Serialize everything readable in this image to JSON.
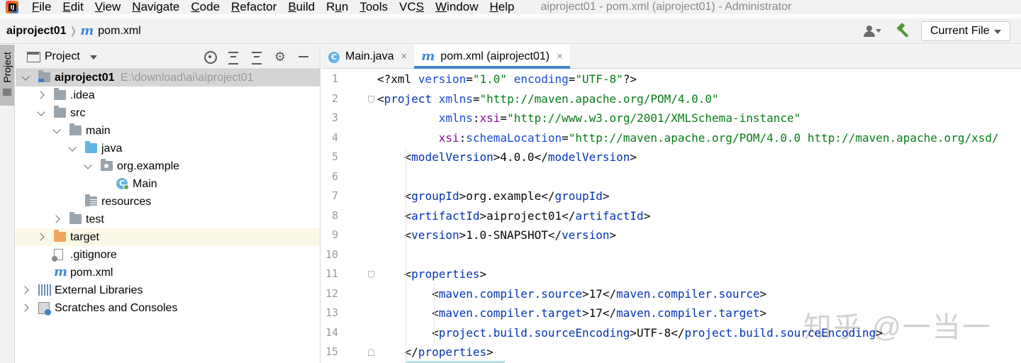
{
  "menubar": {
    "items": [
      {
        "label": "File",
        "mnemonic": "F",
        "rest": "ile"
      },
      {
        "label": "Edit",
        "mnemonic": "E",
        "rest": "dit"
      },
      {
        "label": "View",
        "mnemonic": "V",
        "rest": "iew"
      },
      {
        "label": "Navigate",
        "mnemonic": "N",
        "rest": "avigate"
      },
      {
        "label": "Code",
        "mnemonic": "C",
        "rest": "ode"
      },
      {
        "label": "Refactor",
        "mnemonic": "R",
        "rest": "efactor"
      },
      {
        "label": "Build",
        "mnemonic": "B",
        "rest": "uild"
      },
      {
        "label": "Run",
        "mnemonic": "u",
        "pre": "R",
        "rest": "n"
      },
      {
        "label": "Tools",
        "mnemonic": "T",
        "rest": "ools"
      },
      {
        "label": "VCS",
        "mnemonic": "S",
        "pre": "VC",
        "rest": ""
      },
      {
        "label": "Window",
        "mnemonic": "W",
        "rest": "indow"
      },
      {
        "label": "Help",
        "mnemonic": "H",
        "rest": "elp"
      }
    ],
    "window_title": "aiproject01 - pom.xml (aiproject01) - Administrator"
  },
  "navbar": {
    "project": "aiproject01",
    "maven_glyph": "m",
    "file": "pom.xml",
    "run_config": "Current File"
  },
  "tool_stripe": {
    "project_label": "Project"
  },
  "project_panel": {
    "title": "Project",
    "tree": [
      {
        "label": "aiproject01",
        "path": "E:\\download\\ai\\aiproject01",
        "depth": 0,
        "arrow": "down",
        "icon": "project-folder",
        "selected": true,
        "bold": true
      },
      {
        "label": ".idea",
        "depth": 1,
        "arrow": "right",
        "icon": "folder"
      },
      {
        "label": "src",
        "depth": 1,
        "arrow": "down",
        "icon": "folder"
      },
      {
        "label": "main",
        "depth": 2,
        "arrow": "down",
        "icon": "folder"
      },
      {
        "label": "java",
        "depth": 3,
        "arrow": "down",
        "icon": "source-folder"
      },
      {
        "label": "org.example",
        "depth": 4,
        "arrow": "down",
        "icon": "package-folder"
      },
      {
        "label": "Main",
        "depth": 5,
        "arrow": "none",
        "icon": "class"
      },
      {
        "label": "resources",
        "depth": 3,
        "arrow": "none",
        "icon": "resources-folder"
      },
      {
        "label": "test",
        "depth": 2,
        "arrow": "right",
        "icon": "folder"
      },
      {
        "label": "target",
        "depth": 1,
        "arrow": "right",
        "icon": "excluded-folder",
        "excluded": true
      },
      {
        "label": ".gitignore",
        "depth": 1,
        "arrow": "none",
        "icon": "ignore-file"
      },
      {
        "label": "pom.xml",
        "depth": 1,
        "arrow": "none",
        "icon": "maven-file"
      },
      {
        "label": "External Libraries",
        "depth": 0,
        "arrow": "right",
        "icon": "libraries"
      },
      {
        "label": "Scratches and Consoles",
        "depth": 0,
        "arrow": "right",
        "icon": "scratches"
      }
    ]
  },
  "editor": {
    "tabs": [
      {
        "label": "Main.java",
        "icon": "class",
        "active": false
      },
      {
        "label": "pom.xml (aiproject01)",
        "icon": "maven-file",
        "active": true
      }
    ],
    "tab_class_glyph": "C",
    "close_glyph": "×",
    "lines": [
      {
        "n": "1",
        "indent": "",
        "tokens": [
          [
            "pi",
            "<?xml "
          ],
          [
            "attr",
            "version"
          ],
          [
            "pi",
            "="
          ],
          [
            "val",
            "\"1.0\""
          ],
          [
            "pi",
            " "
          ],
          [
            "attr",
            "encoding"
          ],
          [
            "pi",
            "="
          ],
          [
            "val",
            "\"UTF-8\""
          ],
          [
            "pi",
            "?>"
          ]
        ]
      },
      {
        "n": "2",
        "indent": "",
        "fold": "open",
        "tokens": [
          [
            "txt",
            "<"
          ],
          [
            "tag",
            "project"
          ],
          [
            "txt",
            " "
          ],
          [
            "attr",
            "xmlns"
          ],
          [
            "txt",
            "="
          ],
          [
            "val",
            "\"http://maven.apache.org/POM/4.0.0\""
          ]
        ]
      },
      {
        "n": "3",
        "indent": "         ",
        "tokens": [
          [
            "attr",
            "xmlns"
          ],
          [
            "txt",
            ":"
          ],
          [
            "ns",
            "xsi"
          ],
          [
            "txt",
            "="
          ],
          [
            "val",
            "\"http://www.w3.org/2001/XMLSchema-instance\""
          ]
        ]
      },
      {
        "n": "4",
        "indent": "         ",
        "tokens": [
          [
            "ns",
            "xsi"
          ],
          [
            "txt",
            ":"
          ],
          [
            "attr",
            "schemaLocation"
          ],
          [
            "txt",
            "="
          ],
          [
            "val",
            "\"http://maven.apache.org/POM/4.0.0 http://maven.apache.org/xsd/"
          ]
        ]
      },
      {
        "n": "5",
        "indent": "    ",
        "tokens": [
          [
            "txt",
            "<"
          ],
          [
            "tag",
            "modelVersion"
          ],
          [
            "txt",
            ">4.0.0</"
          ],
          [
            "tag",
            "modelVersion"
          ],
          [
            "txt",
            ">"
          ]
        ]
      },
      {
        "n": "6",
        "indent": "",
        "tokens": []
      },
      {
        "n": "7",
        "indent": "    ",
        "tokens": [
          [
            "txt",
            "<"
          ],
          [
            "tag",
            "groupId"
          ],
          [
            "txt",
            ">org.example</"
          ],
          [
            "tag",
            "groupId"
          ],
          [
            "txt",
            ">"
          ]
        ]
      },
      {
        "n": "8",
        "indent": "    ",
        "tokens": [
          [
            "txt",
            "<"
          ],
          [
            "tag",
            "artifactId"
          ],
          [
            "txt",
            ">aiproject01</"
          ],
          [
            "tag",
            "artifactId"
          ],
          [
            "txt",
            ">"
          ]
        ]
      },
      {
        "n": "9",
        "indent": "    ",
        "tokens": [
          [
            "txt",
            "<"
          ],
          [
            "tag",
            "version"
          ],
          [
            "txt",
            ">1.0-SNAPSHOT</"
          ],
          [
            "tag",
            "version"
          ],
          [
            "txt",
            ">"
          ]
        ]
      },
      {
        "n": "10",
        "indent": "",
        "tokens": []
      },
      {
        "n": "11",
        "indent": "    ",
        "fold": "open",
        "tokens": [
          [
            "txt",
            "<"
          ],
          [
            "tag",
            "properties"
          ],
          [
            "txt",
            ">"
          ]
        ]
      },
      {
        "n": "12",
        "indent": "        ",
        "tokens": [
          [
            "txt",
            "<"
          ],
          [
            "tag",
            "maven.compiler.source"
          ],
          [
            "txt",
            ">17</"
          ],
          [
            "tag",
            "maven.compiler.source"
          ],
          [
            "txt",
            ">"
          ]
        ]
      },
      {
        "n": "13",
        "indent": "        ",
        "tokens": [
          [
            "txt",
            "<"
          ],
          [
            "tag",
            "maven.compiler.target"
          ],
          [
            "txt",
            ">17</"
          ],
          [
            "tag",
            "maven.compiler.target"
          ],
          [
            "txt",
            ">"
          ]
        ]
      },
      {
        "n": "14",
        "indent": "        ",
        "tokens": [
          [
            "txt",
            "<"
          ],
          [
            "tag",
            "project.build.sourceEncoding"
          ],
          [
            "txt",
            ">UTF-8</"
          ],
          [
            "tag",
            "project.build.sourceEncoding"
          ],
          [
            "txt",
            ">"
          ]
        ]
      },
      {
        "n": "15",
        "indent": "    ",
        "fold": "close",
        "tokens": [
          [
            "txt",
            "</"
          ],
          [
            "tag",
            "properties"
          ],
          [
            "txt",
            ">"
          ]
        ]
      }
    ],
    "watermark": "知乎 @一当一"
  }
}
